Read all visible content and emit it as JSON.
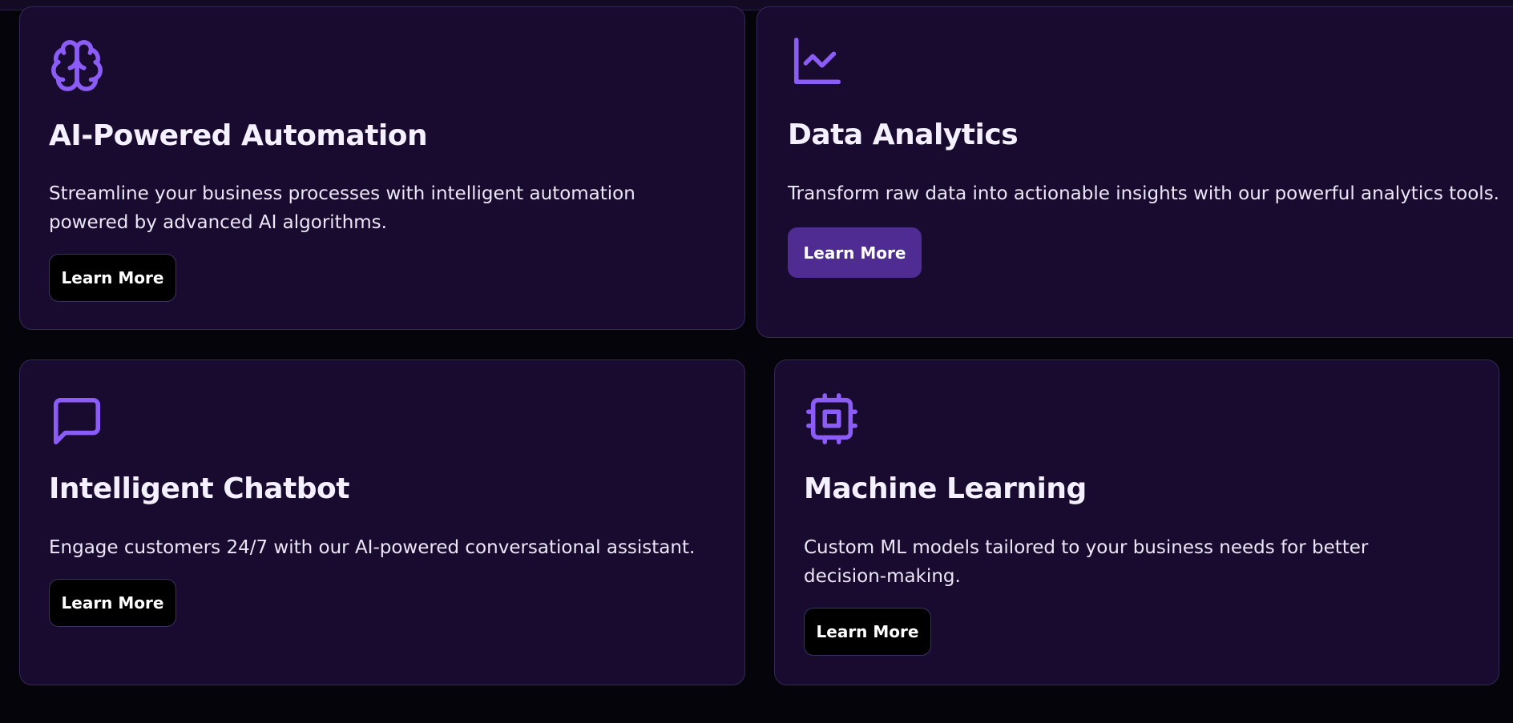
{
  "colors": {
    "page_background": "#05040a",
    "card_background": "#180b2f",
    "card_border": "#34295a",
    "accent": "#8b5cf6",
    "primary_button": "#4e2c91",
    "secondary_button": "#000000"
  },
  "cards": [
    {
      "icon": "brain-icon",
      "title": "AI-Powered Automation",
      "description": "Streamline your business processes with intelligent automation powered by advanced AI algorithms.",
      "button_label": "Learn More"
    },
    {
      "icon": "line-chart-icon",
      "title": "Data Analytics",
      "description": "Transform raw data into actionable insights with our powerful analytics tools.",
      "button_label": "Learn More",
      "button_state": "hover"
    },
    {
      "icon": "message-square-icon",
      "title": "Intelligent Chatbot",
      "description": "Engage customers 24/7 with our AI-powered conversational assistant.",
      "button_label": "Learn More"
    },
    {
      "icon": "cpu-chip-icon",
      "title": "Machine Learning",
      "description": "Custom ML models tailored to your business needs for better decision-making.",
      "button_label": "Learn More"
    }
  ]
}
